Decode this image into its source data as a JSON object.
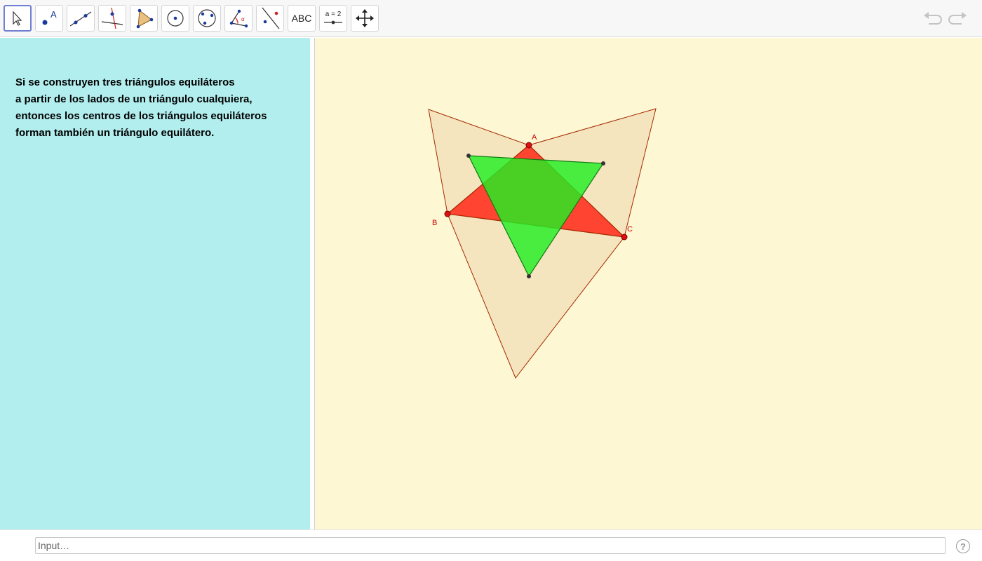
{
  "toolbar": {
    "tools": [
      {
        "name": "move-tool",
        "active": true
      },
      {
        "name": "point-tool",
        "label": "A"
      },
      {
        "name": "line-tool"
      },
      {
        "name": "perpendicular-line-tool"
      },
      {
        "name": "polygon-tool"
      },
      {
        "name": "circle-tool"
      },
      {
        "name": "circle-through-three-points-tool"
      },
      {
        "name": "angle-tool",
        "label": "α"
      },
      {
        "name": "reflect-tool"
      },
      {
        "name": "text-tool",
        "label": "ABC"
      },
      {
        "name": "slider-tool",
        "label": "a = 2"
      },
      {
        "name": "move-graphics-view-tool"
      }
    ]
  },
  "algebra": {
    "lines": [
      "Si se construyen tres triángulos equiláteros",
      "a partir de los lados de un triángulo cualquiera,",
      "entonces los centros de los triángulos equiláteros",
      "forman también un triángulo equilátero."
    ]
  },
  "graphics": {
    "points": {
      "A": "A",
      "B": "B",
      "C": "C"
    }
  },
  "input": {
    "placeholder": "Input…"
  },
  "help": {
    "label": "?"
  },
  "colors": {
    "algebra_bg": "#b2eeee",
    "graphics_bg": "#fdf8d3",
    "outer_fill": "#f3e2bd",
    "outline": "#a52a00",
    "triangle_fill": "#ff2a1a",
    "napoleon_fill": "#22ee22",
    "accent": "#6f7fd1"
  }
}
